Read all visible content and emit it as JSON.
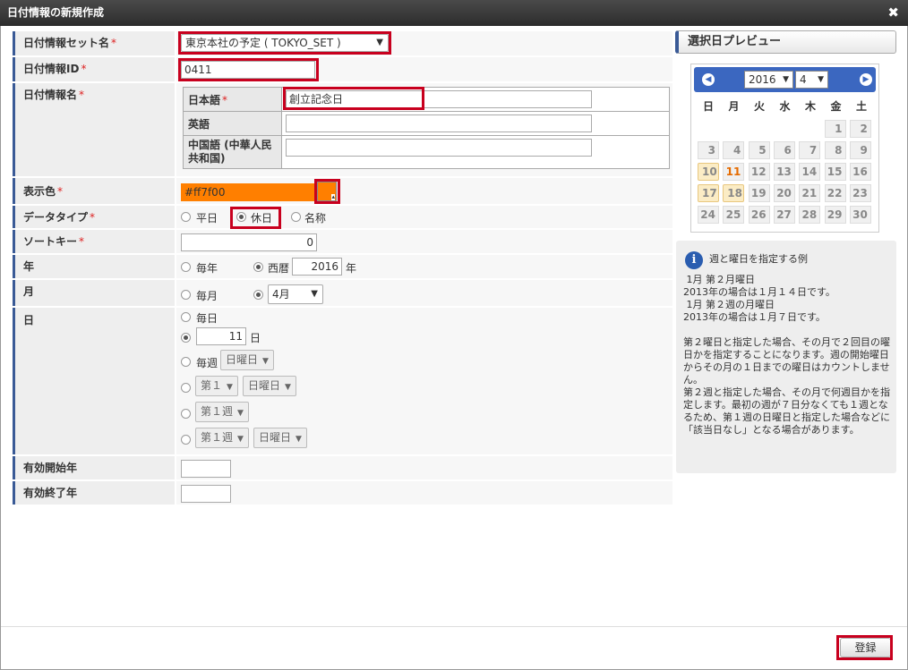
{
  "window": {
    "title": "日付情報の新規作成",
    "close_glyph": "✖"
  },
  "form": {
    "set_name": {
      "label": "日付情報セット名",
      "required": "*",
      "value": "東京本社の予定 ( TOKYO_SET )"
    },
    "id": {
      "label": "日付情報ID",
      "required": "*",
      "value": "0411"
    },
    "name": {
      "label": "日付情報名",
      "required": "*",
      "rows": [
        {
          "lang": "日本語",
          "required": "*",
          "value": "創立記念日"
        },
        {
          "lang": "英語",
          "value": ""
        },
        {
          "lang": "中国語 (中華人民共和国)",
          "value": ""
        }
      ]
    },
    "color": {
      "label": "表示色",
      "required": "*",
      "value": "#ff7f00",
      "swatch": "#ff7f00"
    },
    "data_type": {
      "label": "データタイプ",
      "required": "*",
      "options": [
        "平日",
        "休日",
        "名称"
      ],
      "selected": "休日"
    },
    "sort_key": {
      "label": "ソートキー",
      "required": "*",
      "value": "0"
    },
    "year": {
      "label": "年",
      "opt_every": "毎年",
      "opt_ad": "西暦",
      "value": "2016",
      "unit": "年",
      "selected": "西暦"
    },
    "month": {
      "label": "月",
      "opt_every": "毎月",
      "value": "4月",
      "selected": "select"
    },
    "day": {
      "label": "日",
      "opt_every": "毎日",
      "value": "11",
      "unit": "日",
      "opt_weekly": "毎週",
      "weekday": "日曜日",
      "nth": "第１",
      "nth_week": "第１週"
    },
    "valid_start": {
      "label": "有効開始年",
      "value": ""
    },
    "valid_end": {
      "label": "有効終了年",
      "value": ""
    }
  },
  "preview": {
    "header": "選択日プレビュー",
    "year": "2016",
    "month": "4",
    "weekdays": [
      "日",
      "月",
      "火",
      "水",
      "木",
      "金",
      "土"
    ],
    "weeks": [
      [
        "",
        "",
        "",
        "",
        "",
        "1",
        "2"
      ],
      [
        "3",
        "4",
        "5",
        "6",
        "7",
        "8",
        "9"
      ],
      [
        "10",
        "11",
        "12",
        "13",
        "14",
        "15",
        "16"
      ],
      [
        "17",
        "18",
        "19",
        "20",
        "21",
        "22",
        "23"
      ],
      [
        "24",
        "25",
        "26",
        "27",
        "28",
        "29",
        "30"
      ]
    ],
    "today": "11",
    "selected": [
      "10",
      "17",
      "18"
    ]
  },
  "info": {
    "title": "週と曜日を指定する例",
    "body": " 1月 第２月曜日\n2013年の場合は１月１４日です。\n 1月 第２週の月曜日\n2013年の場合は１月７日です。\n\n第２曜日と指定した場合、その月で２回目の曜日かを指定することになります。週の開始曜日からその月の１日までの曜日はカウントしません。\n第２週と指定した場合、その月で何週目かを指定します。最初の週が７日分なくても１週となるため、第１週の日曜日と指定した場合などに「該当日なし」となる場合があります。"
  },
  "footer": {
    "submit": "登録"
  }
}
